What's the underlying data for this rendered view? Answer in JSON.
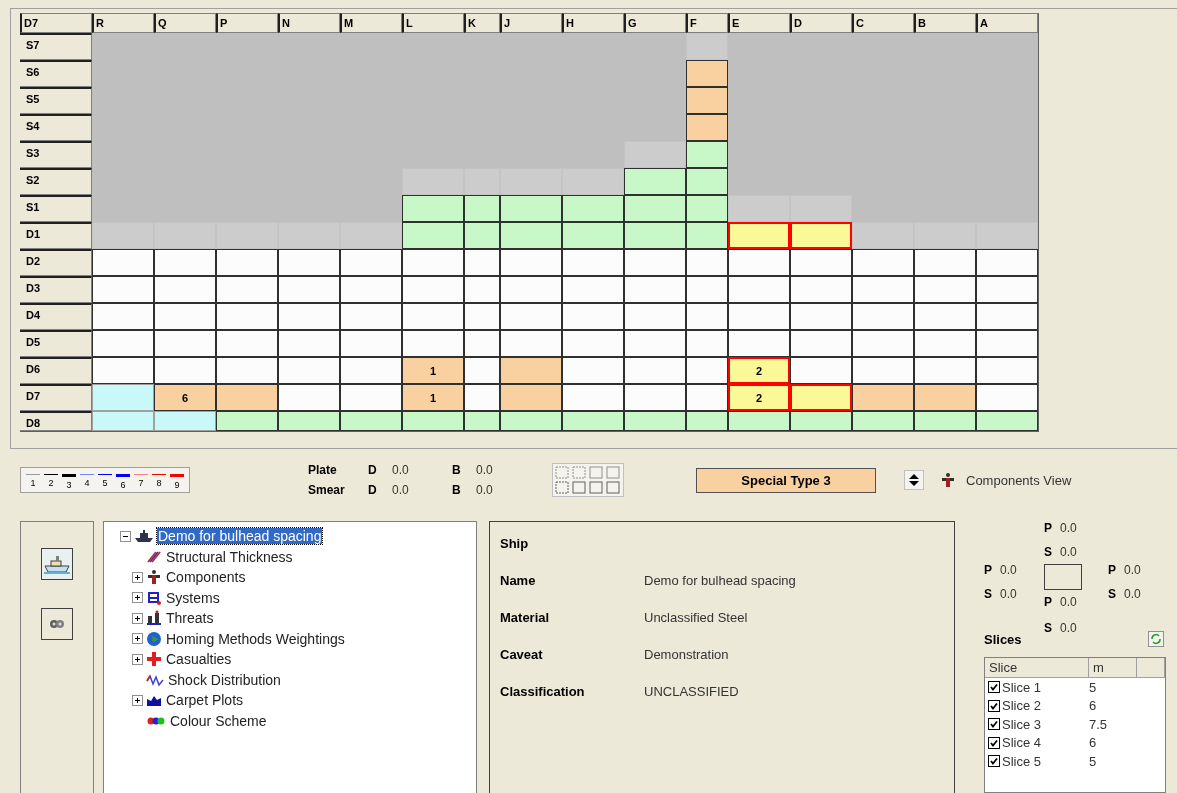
{
  "grid": {
    "corner": "D7",
    "columns": [
      "R",
      "Q",
      "P",
      "N",
      "M",
      "L",
      "K",
      "J",
      "H",
      "G",
      "F",
      "E",
      "D",
      "C",
      "B",
      "A"
    ],
    "rows": [
      {
        "label": "S7",
        "cells": [
          {
            "kind": "void"
          },
          {
            "kind": "void"
          },
          {
            "kind": "void"
          },
          {
            "kind": "void"
          },
          {
            "kind": "void"
          },
          {
            "kind": "void"
          },
          {
            "kind": "void"
          },
          {
            "kind": "void"
          },
          {
            "kind": "void"
          },
          {
            "kind": "void"
          },
          {
            "kind": "empty"
          },
          {
            "kind": "void"
          },
          {
            "kind": "void"
          },
          {
            "kind": "void"
          },
          {
            "kind": "void"
          },
          {
            "kind": "void"
          }
        ]
      },
      {
        "label": "S6",
        "cells": [
          {
            "kind": "void"
          },
          {
            "kind": "void"
          },
          {
            "kind": "void"
          },
          {
            "kind": "void"
          },
          {
            "kind": "void"
          },
          {
            "kind": "void"
          },
          {
            "kind": "void"
          },
          {
            "kind": "void"
          },
          {
            "kind": "void"
          },
          {
            "kind": "void"
          },
          {
            "kind": "orange"
          },
          {
            "kind": "void"
          },
          {
            "kind": "void"
          },
          {
            "kind": "void"
          },
          {
            "kind": "void"
          },
          {
            "kind": "void"
          }
        ]
      },
      {
        "label": "S5",
        "cells": [
          {
            "kind": "void"
          },
          {
            "kind": "void"
          },
          {
            "kind": "void"
          },
          {
            "kind": "void"
          },
          {
            "kind": "void"
          },
          {
            "kind": "void"
          },
          {
            "kind": "void"
          },
          {
            "kind": "void"
          },
          {
            "kind": "void"
          },
          {
            "kind": "void"
          },
          {
            "kind": "orange"
          },
          {
            "kind": "void"
          },
          {
            "kind": "void"
          },
          {
            "kind": "void"
          },
          {
            "kind": "void"
          },
          {
            "kind": "void"
          }
        ]
      },
      {
        "label": "S4",
        "cells": [
          {
            "kind": "void"
          },
          {
            "kind": "void"
          },
          {
            "kind": "void"
          },
          {
            "kind": "void"
          },
          {
            "kind": "void"
          },
          {
            "kind": "void"
          },
          {
            "kind": "void"
          },
          {
            "kind": "void"
          },
          {
            "kind": "void"
          },
          {
            "kind": "void"
          },
          {
            "kind": "orange"
          },
          {
            "kind": "void"
          },
          {
            "kind": "void"
          },
          {
            "kind": "void"
          },
          {
            "kind": "void"
          },
          {
            "kind": "void"
          }
        ]
      },
      {
        "label": "S3",
        "cells": [
          {
            "kind": "void"
          },
          {
            "kind": "void"
          },
          {
            "kind": "void"
          },
          {
            "kind": "void"
          },
          {
            "kind": "void"
          },
          {
            "kind": "void"
          },
          {
            "kind": "void"
          },
          {
            "kind": "void"
          },
          {
            "kind": "void"
          },
          {
            "kind": "empty"
          },
          {
            "kind": "green"
          },
          {
            "kind": "void"
          },
          {
            "kind": "void"
          },
          {
            "kind": "void"
          },
          {
            "kind": "void"
          },
          {
            "kind": "void"
          }
        ]
      },
      {
        "label": "S2",
        "cells": [
          {
            "kind": "void"
          },
          {
            "kind": "void"
          },
          {
            "kind": "void"
          },
          {
            "kind": "void"
          },
          {
            "kind": "void"
          },
          {
            "kind": "empty"
          },
          {
            "kind": "empty"
          },
          {
            "kind": "empty"
          },
          {
            "kind": "empty"
          },
          {
            "kind": "green"
          },
          {
            "kind": "green"
          },
          {
            "kind": "void"
          },
          {
            "kind": "void"
          },
          {
            "kind": "void"
          },
          {
            "kind": "void"
          },
          {
            "kind": "void"
          }
        ]
      },
      {
        "label": "S1",
        "cells": [
          {
            "kind": "void"
          },
          {
            "kind": "void"
          },
          {
            "kind": "void"
          },
          {
            "kind": "void"
          },
          {
            "kind": "void"
          },
          {
            "kind": "green"
          },
          {
            "kind": "green"
          },
          {
            "kind": "green"
          },
          {
            "kind": "green"
          },
          {
            "kind": "green"
          },
          {
            "kind": "green"
          },
          {
            "kind": "empty"
          },
          {
            "kind": "empty"
          },
          {
            "kind": "void"
          },
          {
            "kind": "void"
          },
          {
            "kind": "void"
          }
        ]
      },
      {
        "label": "D1",
        "cells": [
          {
            "kind": "empty"
          },
          {
            "kind": "empty"
          },
          {
            "kind": "empty"
          },
          {
            "kind": "empty"
          },
          {
            "kind": "empty"
          },
          {
            "kind": "green"
          },
          {
            "kind": "green"
          },
          {
            "kind": "green"
          },
          {
            "kind": "green"
          },
          {
            "kind": "green"
          },
          {
            "kind": "green"
          },
          {
            "kind": "yellow"
          },
          {
            "kind": "yellow"
          },
          {
            "kind": "empty"
          },
          {
            "kind": "empty"
          },
          {
            "kind": "empty"
          }
        ]
      },
      {
        "label": "D2",
        "cells": [
          {
            "kind": "white"
          },
          {
            "kind": "white"
          },
          {
            "kind": "white"
          },
          {
            "kind": "white"
          },
          {
            "kind": "white"
          },
          {
            "kind": "white"
          },
          {
            "kind": "white"
          },
          {
            "kind": "white"
          },
          {
            "kind": "white"
          },
          {
            "kind": "white"
          },
          {
            "kind": "white"
          },
          {
            "kind": "white"
          },
          {
            "kind": "white"
          },
          {
            "kind": "white"
          },
          {
            "kind": "white"
          },
          {
            "kind": "white"
          }
        ]
      },
      {
        "label": "D3",
        "cells": [
          {
            "kind": "white"
          },
          {
            "kind": "white"
          },
          {
            "kind": "white"
          },
          {
            "kind": "white"
          },
          {
            "kind": "white"
          },
          {
            "kind": "white"
          },
          {
            "kind": "white"
          },
          {
            "kind": "white"
          },
          {
            "kind": "white"
          },
          {
            "kind": "white"
          },
          {
            "kind": "white"
          },
          {
            "kind": "white"
          },
          {
            "kind": "white"
          },
          {
            "kind": "white"
          },
          {
            "kind": "white"
          },
          {
            "kind": "white"
          }
        ]
      },
      {
        "label": "D4",
        "cells": [
          {
            "kind": "white"
          },
          {
            "kind": "white"
          },
          {
            "kind": "white"
          },
          {
            "kind": "white"
          },
          {
            "kind": "white"
          },
          {
            "kind": "white"
          },
          {
            "kind": "white"
          },
          {
            "kind": "white"
          },
          {
            "kind": "white"
          },
          {
            "kind": "white"
          },
          {
            "kind": "white"
          },
          {
            "kind": "white"
          },
          {
            "kind": "white"
          },
          {
            "kind": "white"
          },
          {
            "kind": "white"
          },
          {
            "kind": "white"
          }
        ]
      },
      {
        "label": "D5",
        "cells": [
          {
            "kind": "white"
          },
          {
            "kind": "white"
          },
          {
            "kind": "white"
          },
          {
            "kind": "white"
          },
          {
            "kind": "white"
          },
          {
            "kind": "white"
          },
          {
            "kind": "white"
          },
          {
            "kind": "white"
          },
          {
            "kind": "white"
          },
          {
            "kind": "white"
          },
          {
            "kind": "white"
          },
          {
            "kind": "white"
          },
          {
            "kind": "white"
          },
          {
            "kind": "white"
          },
          {
            "kind": "white"
          },
          {
            "kind": "white"
          }
        ]
      },
      {
        "label": "D6",
        "cells": [
          {
            "kind": "white"
          },
          {
            "kind": "white"
          },
          {
            "kind": "white"
          },
          {
            "kind": "white"
          },
          {
            "kind": "white"
          },
          {
            "kind": "orange",
            "text": "1"
          },
          {
            "kind": "white"
          },
          {
            "kind": "orange"
          },
          {
            "kind": "white"
          },
          {
            "kind": "white"
          },
          {
            "kind": "white"
          },
          {
            "kind": "yellow",
            "text": "2"
          },
          {
            "kind": "white"
          },
          {
            "kind": "white"
          },
          {
            "kind": "white"
          },
          {
            "kind": "white"
          }
        ]
      },
      {
        "label": "D7",
        "cells": [
          {
            "kind": "cyan"
          },
          {
            "kind": "orange",
            "text": "6"
          },
          {
            "kind": "orange"
          },
          {
            "kind": "white"
          },
          {
            "kind": "white"
          },
          {
            "kind": "orange",
            "text": "1"
          },
          {
            "kind": "white"
          },
          {
            "kind": "orange"
          },
          {
            "kind": "white"
          },
          {
            "kind": "white"
          },
          {
            "kind": "white"
          },
          {
            "kind": "yellow",
            "text": "2"
          },
          {
            "kind": "yellow"
          },
          {
            "kind": "orange"
          },
          {
            "kind": "orange"
          },
          {
            "kind": "white"
          }
        ]
      },
      {
        "label": "D8",
        "cells": [
          {
            "kind": "cyan"
          },
          {
            "kind": "cyan"
          },
          {
            "kind": "green"
          },
          {
            "kind": "green"
          },
          {
            "kind": "green"
          },
          {
            "kind": "green"
          },
          {
            "kind": "green"
          },
          {
            "kind": "green"
          },
          {
            "kind": "green"
          },
          {
            "kind": "green"
          },
          {
            "kind": "green"
          },
          {
            "kind": "green"
          },
          {
            "kind": "green"
          },
          {
            "kind": "green"
          },
          {
            "kind": "green"
          },
          {
            "kind": "green"
          }
        ]
      }
    ]
  },
  "legend": [
    {
      "label": "1",
      "color": "#9a9a9a",
      "kind": "thin"
    },
    {
      "label": "2",
      "color": "#000000",
      "kind": "thin"
    },
    {
      "label": "3",
      "color": "#000000",
      "kind": "thick"
    },
    {
      "label": "4",
      "color": "#8080ff",
      "kind": "thin"
    },
    {
      "label": "5",
      "color": "#0000ff",
      "kind": "thin"
    },
    {
      "label": "6",
      "color": "#0000ff",
      "kind": "thick"
    },
    {
      "label": "7",
      "color": "#ff8080",
      "kind": "thin"
    },
    {
      "label": "8",
      "color": "#ff0000",
      "kind": "thin"
    },
    {
      "label": "9",
      "color": "#ff0000",
      "kind": "thick"
    }
  ],
  "thickness": [
    {
      "label": "Plate",
      "values": [
        {
          "label": "D",
          "value": "0.0"
        },
        {
          "label": "B",
          "value": "0.0"
        }
      ]
    },
    {
      "label": "Smear",
      "values": [
        {
          "label": "D",
          "value": "0.0"
        },
        {
          "label": "B",
          "value": "0.0"
        }
      ]
    }
  ],
  "type_badge": "Special Type 3",
  "components_view": "Components View",
  "tree": {
    "label": "Demo for bulhead spacing",
    "selected": true,
    "expanded": true,
    "children": [
      {
        "label": "Structural Thickness",
        "selected": false
      },
      {
        "label": "Components",
        "selected": false,
        "expanded": false
      },
      {
        "label": "Systems",
        "selected": false,
        "expanded": false
      },
      {
        "label": "Threats",
        "selected": false,
        "expanded": false
      },
      {
        "label": "Homing Methods Weightings",
        "selected": false,
        "expanded": false
      },
      {
        "label": "Casualties",
        "selected": false,
        "expanded": false
      },
      {
        "label": "Shock Distribution",
        "selected": false
      },
      {
        "label": "Carpet Plots",
        "selected": false,
        "expanded": false
      },
      {
        "label": "Colour Scheme",
        "selected": false
      }
    ]
  },
  "details": {
    "title": "Ship",
    "fields": [
      {
        "label": "Name",
        "value": "Demo for bulhead spacing"
      },
      {
        "label": "Material",
        "value": "Unclassified Steel"
      },
      {
        "label": "Caveat",
        "value": "Demonstration"
      },
      {
        "label": "Classification",
        "value": "UNCLASSIFIED"
      }
    ]
  },
  "sides": {
    "top": [
      {
        "label": "P",
        "value": "0.0"
      },
      {
        "label": "S",
        "value": "0.0"
      }
    ],
    "left": [
      {
        "label": "P",
        "value": "0.0"
      },
      {
        "label": "S",
        "value": "0.0"
      }
    ],
    "right": [
      {
        "label": "P",
        "value": "0.0"
      },
      {
        "label": "S",
        "value": "0.0"
      }
    ],
    "bottom": [
      {
        "label": "P",
        "value": "0.0"
      },
      {
        "label": "S",
        "value": "0.0"
      }
    ]
  },
  "slices": {
    "title": "Slices",
    "columns": [
      "Slice",
      "m"
    ],
    "rows": [
      {
        "name": "Slice 1",
        "m": "5",
        "checked": true
      },
      {
        "name": "Slice 2",
        "m": "6",
        "checked": true
      },
      {
        "name": "Slice 3",
        "m": "7.5",
        "checked": true
      },
      {
        "name": "Slice 4",
        "m": "6",
        "checked": true
      },
      {
        "name": "Slice 5",
        "m": "5",
        "checked": true
      }
    ]
  }
}
